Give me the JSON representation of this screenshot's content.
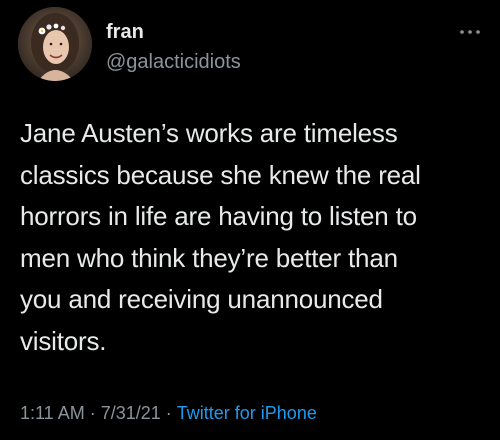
{
  "user": {
    "display_name": "fran",
    "handle": "@galacticidiots"
  },
  "tweet": {
    "text_lines": [
      "Jane Austen’s works are timeless",
      "classics because she knew the real",
      "horrors in life are having to listen to",
      "men who think they’re better than",
      "you and receiving unannounced",
      "visitors."
    ],
    "time": "1:11 AM",
    "date": "7/31/21",
    "separator": "·",
    "source": "Twitter for iPhone"
  },
  "icons": {
    "more": "more-horizontal-icon"
  },
  "colors": {
    "background": "#000000",
    "text": "#e7e9ea",
    "secondary_text": "#8b949a",
    "link": "#1d9bf0"
  }
}
